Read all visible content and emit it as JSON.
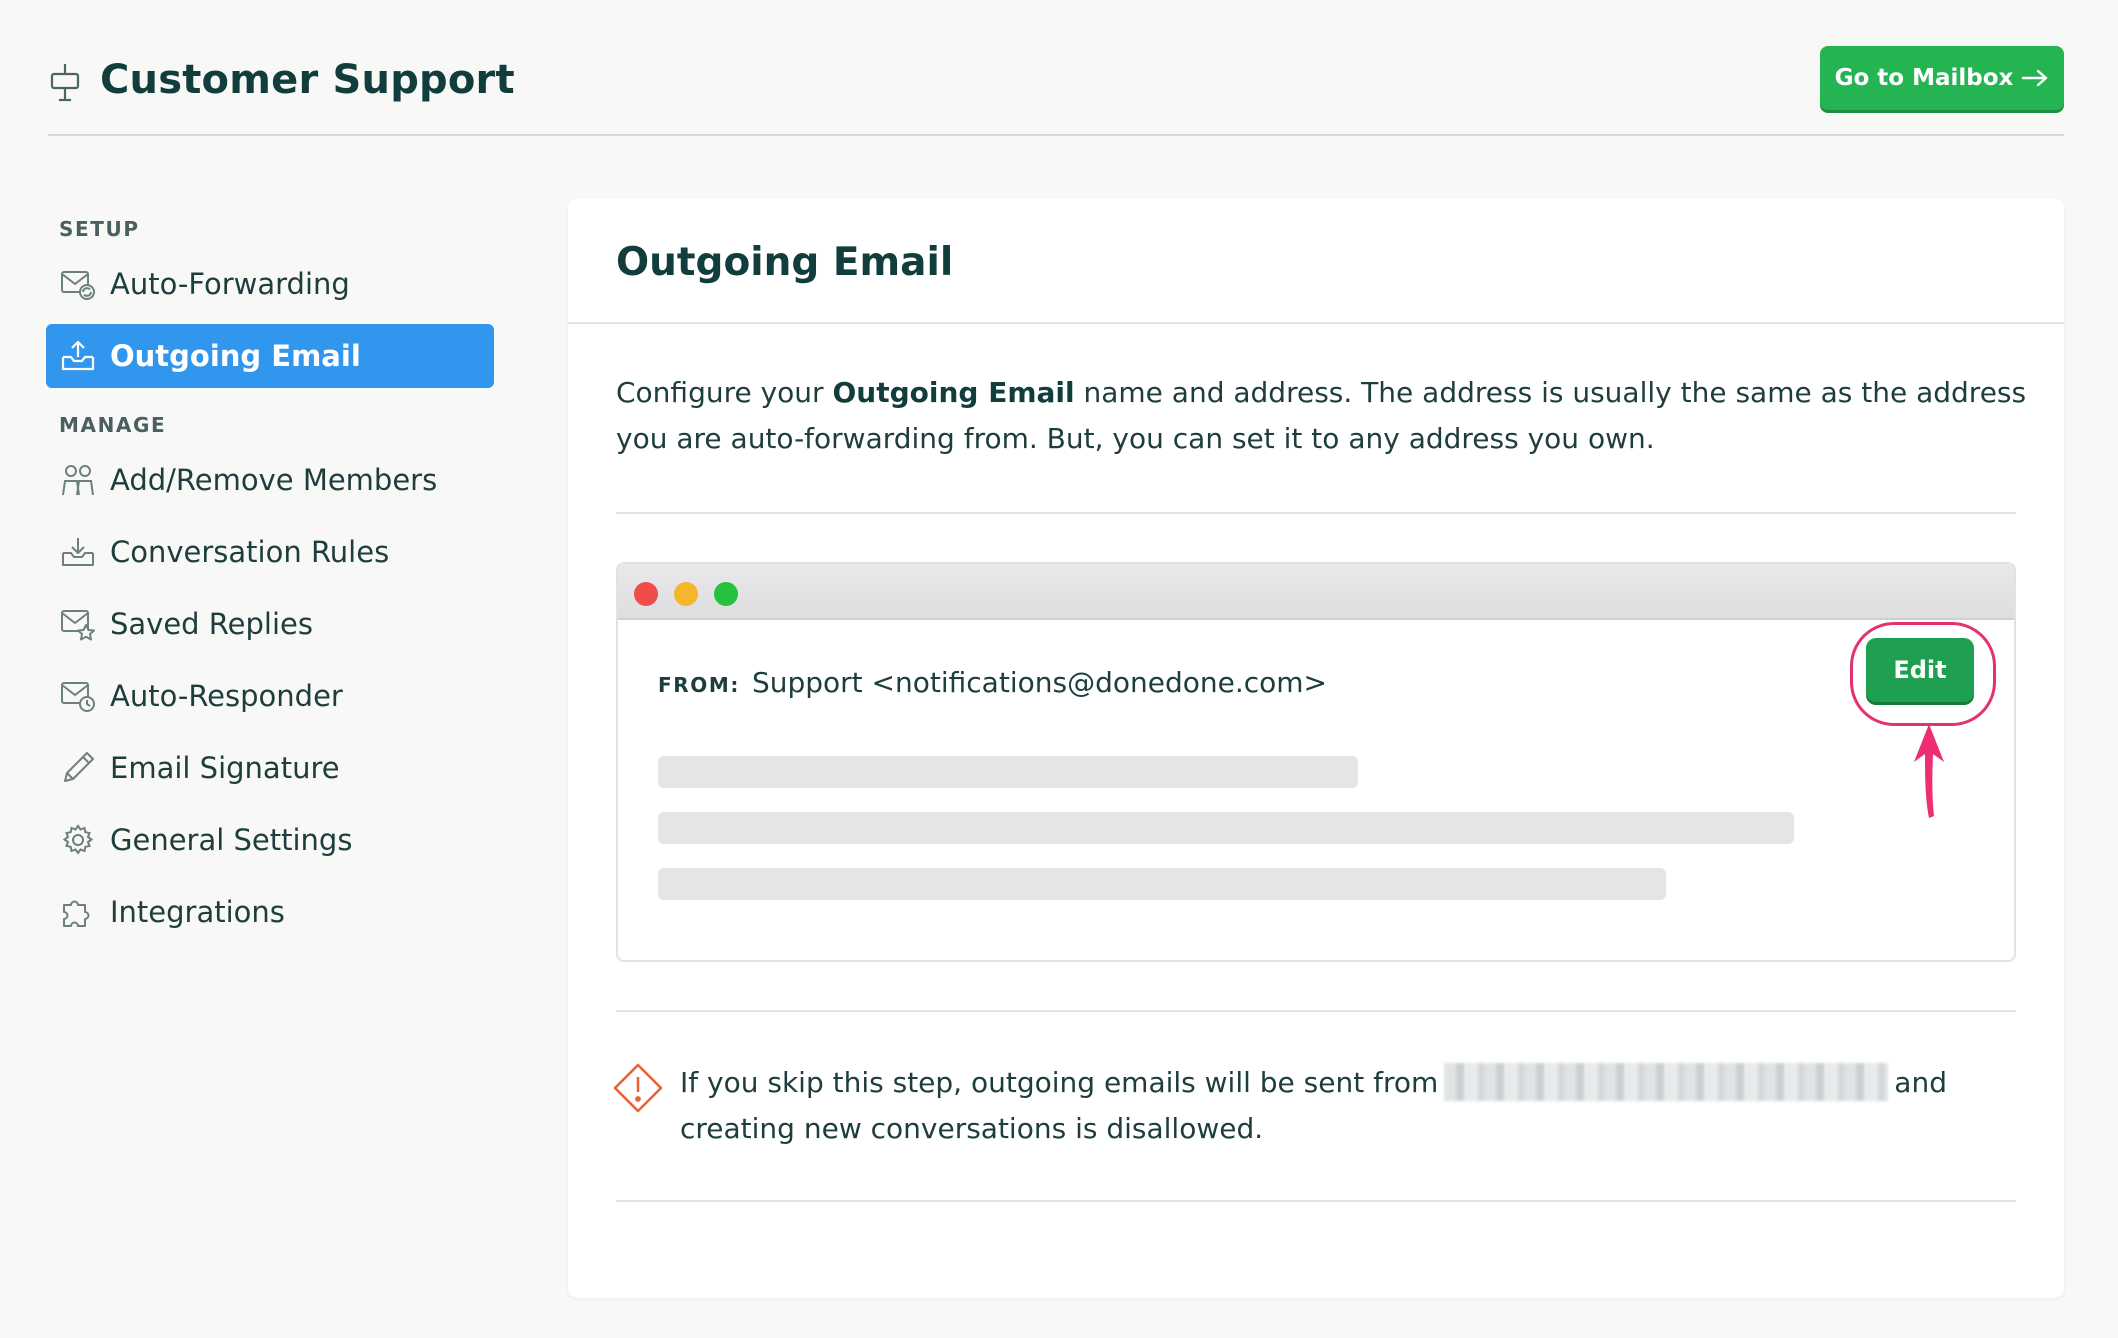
{
  "header": {
    "title": "Customer Support",
    "mailbox_button": "Go to Mailbox"
  },
  "sidebar": {
    "setup_label": "SETUP",
    "manage_label": "MANAGE",
    "setup_items": [
      {
        "label": "Auto-Forwarding",
        "icon": "mail-forward-icon"
      },
      {
        "label": "Outgoing Email",
        "icon": "outbox-icon",
        "active": true
      }
    ],
    "manage_items": [
      {
        "label": "Add/Remove Members",
        "icon": "members-icon"
      },
      {
        "label": "Conversation Rules",
        "icon": "inbox-download-icon"
      },
      {
        "label": "Saved Replies",
        "icon": "mail-star-icon"
      },
      {
        "label": "Auto-Responder",
        "icon": "mail-clock-icon"
      },
      {
        "label": "Email Signature",
        "icon": "pencil-icon"
      },
      {
        "label": "General Settings",
        "icon": "gear-icon"
      },
      {
        "label": "Integrations",
        "icon": "puzzle-icon"
      }
    ]
  },
  "main": {
    "title": "Outgoing Email",
    "intro_before": "Configure your ",
    "intro_bold": "Outgoing Email",
    "intro_after": " name and address. The address is usually the same as the address you are auto-forwarding from. But, you can set it to any address you own.",
    "from_label": "FROM:",
    "from_value": "Support <notifications@donedone.com>",
    "edit_button": "Edit",
    "warning_before": "If you skip this step, outgoing emails will be sent from",
    "warning_after": "and creating new conversations is disallowed."
  },
  "colors": {
    "accent_green": "#24b552",
    "active_blue": "#3196ee",
    "highlight_pink": "#e3336d",
    "warning_orange": "#e8623a"
  }
}
